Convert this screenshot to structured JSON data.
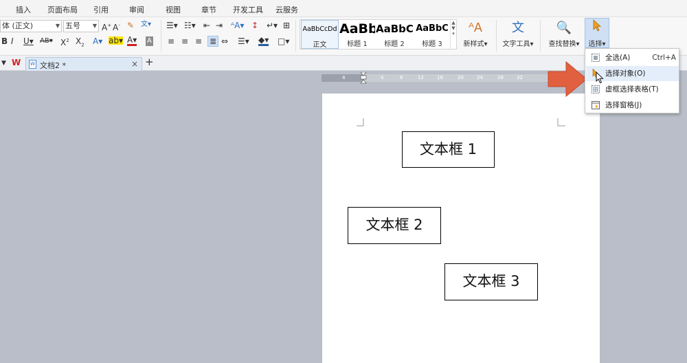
{
  "menubar": {
    "tabs": [
      {
        "label": "插入"
      },
      {
        "label": "页面布局"
      },
      {
        "label": "引用"
      },
      {
        "label": "审阅"
      },
      {
        "label": "视图"
      },
      {
        "label": "章节"
      },
      {
        "label": "开发工具"
      },
      {
        "label": "云服务"
      }
    ]
  },
  "ribbon": {
    "font_name": "体 (正文)",
    "font_size": "五号",
    "styles": [
      {
        "sample": "AaBbCcDd",
        "label": "正文"
      },
      {
        "sample": "AaBb",
        "label": "标题 1"
      },
      {
        "sample": "AaBbC",
        "label": "标题 2"
      },
      {
        "sample": "AaBbC",
        "label": "标题 3"
      }
    ],
    "new_style_label": "新样式",
    "text_tools_label": "文字工具",
    "find_replace_label": "查找替换",
    "select_label": "选择"
  },
  "tabs": {
    "doc_name": "文档2 *",
    "close_symbol": "×",
    "add_symbol": "+"
  },
  "ruler": {
    "ticks": [
      "4",
      "4",
      "8",
      "12",
      "16",
      "20",
      "24",
      "28",
      "32"
    ]
  },
  "page": {
    "textboxes": [
      {
        "text": "文本框 1"
      },
      {
        "text": "文本框 2"
      },
      {
        "text": "文本框 3"
      }
    ]
  },
  "dropdown": {
    "items": [
      {
        "label": "全选(A)",
        "shortcut": "Ctrl+A",
        "icon": "select-all-icon"
      },
      {
        "label": "选择对象(O)",
        "shortcut": "",
        "icon": "select-object-icon"
      },
      {
        "label": "虚框选择表格(T)",
        "shortcut": "",
        "icon": "marquee-table-icon"
      },
      {
        "label": "选择窗格(J)",
        "shortcut": "",
        "icon": "selection-pane-icon"
      }
    ]
  },
  "colors": {
    "accent": "#2e6fbf",
    "arrow": "#e0603f",
    "highlight": "#e4eefa",
    "workspace": "#b9bec8"
  }
}
